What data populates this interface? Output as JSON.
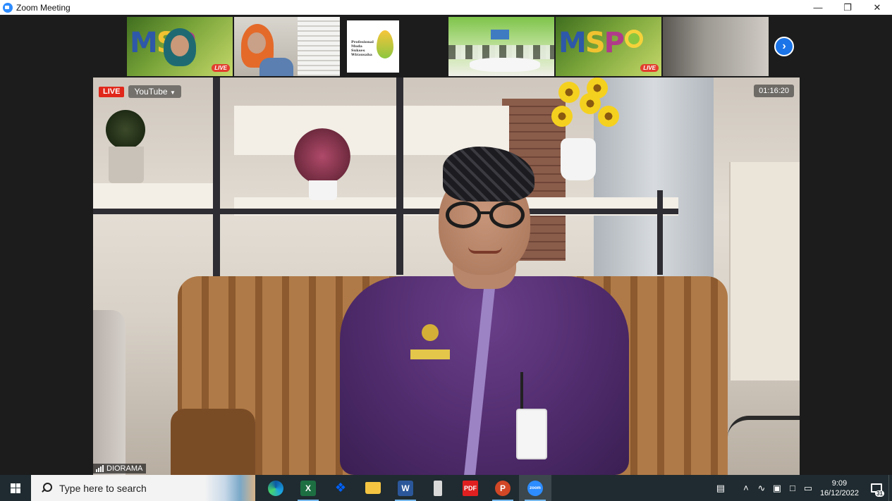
{
  "window": {
    "title": "Zoom Meeting",
    "controls": [
      "minimize",
      "restore",
      "close"
    ]
  },
  "thumbnails": [
    {
      "id": "participant-1",
      "name": "MSPO banner with presenter",
      "msp_letters": [
        "M",
        "S",
        "P"
      ],
      "live_label": "LIVE"
    },
    {
      "id": "participant-2",
      "name": "Participant in orange hijab"
    },
    {
      "id": "participant-3",
      "name": "Professional logo card",
      "logo_text": "Profesional Muda Sukses Wirausaha"
    },
    {
      "id": "participant-4",
      "name": "Meeting room group"
    },
    {
      "id": "participant-5",
      "name": "MSPO banner",
      "msp_letters": [
        "M",
        "S",
        "P"
      ],
      "live_label": "LIVE"
    },
    {
      "id": "participant-6",
      "name": "Room view"
    }
  ],
  "main_video": {
    "live_label": "LIVE",
    "stream_label": "YouTube",
    "timer": "01:16:20",
    "speaker_name": "DIORAMA"
  },
  "taskbar": {
    "search_placeholder": "Type here to search",
    "apps": [
      {
        "name": "edge",
        "label": ""
      },
      {
        "name": "excel",
        "label": "X"
      },
      {
        "name": "dropbox",
        "label": "❖"
      },
      {
        "name": "file-explorer",
        "label": ""
      },
      {
        "name": "word",
        "label": "W"
      },
      {
        "name": "usb-drive",
        "label": ""
      },
      {
        "name": "pdf-reader",
        "label": "PDF"
      },
      {
        "name": "powerpoint",
        "label": "P"
      },
      {
        "name": "zoom",
        "label": "zoom"
      }
    ],
    "time": "9:09",
    "date": "16/12/2022",
    "notification_count": "31"
  },
  "colors": {
    "accent": "#2d8cff",
    "live": "#e0271a",
    "taskbar": "#1f2b30"
  }
}
